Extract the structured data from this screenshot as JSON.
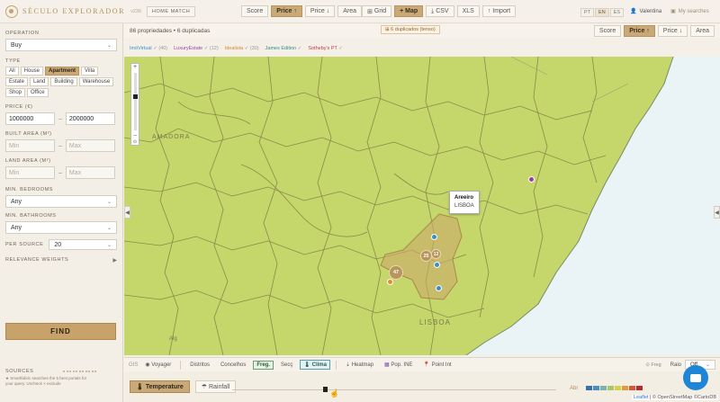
{
  "header": {
    "logo": "SÉCULO EXPLORADOR",
    "version": "v236",
    "home_match": "HOME MATCH",
    "sort": [
      "Score",
      "Price ↑",
      "Price ↓",
      "Area"
    ],
    "views": {
      "grid": "Grid",
      "map": "+ Map",
      "csv": "⤓ CSV",
      "xls": "XLS",
      "import": "↑ Import"
    },
    "langs": [
      "PT",
      "EN",
      "ES"
    ],
    "user": "Valentina",
    "my_searches": "My searches"
  },
  "sidebar": {
    "operation_label": "OPERATION",
    "operation_value": "Buy",
    "type_label": "TYPE",
    "types": [
      "All",
      "House",
      "Apartment",
      "Villa",
      "Estate",
      "Land",
      "Building",
      "Warehouse",
      "Shop",
      "Office"
    ],
    "price_label": "PRICE (€)",
    "price_min": "1000000",
    "price_max": "2000000",
    "built_label": "BUILT AREA (M²)",
    "land_label": "LAND AREA (M²)",
    "min_placeholder": "Min",
    "max_placeholder": "Max",
    "bedrooms_label": "MIN. BEDROOMS",
    "bedrooms_value": "Any",
    "bathrooms_label": "MIN. BATHROOMS",
    "bathrooms_value": "Any",
    "per_source_label": "PER SOURCE",
    "per_source_value": "20",
    "relevance_label": "RELEVANCE WEIGHTS",
    "find": "FIND",
    "sources_label": "SOURCES",
    "sources_note_1": "★ Smartfabric searches the 5 best portals for",
    "sources_note_2": "your query. Uncheck × exclude"
  },
  "results": {
    "count": "86 propriedades • 6 duplicadas",
    "duplicates": "⊞ 6 duplicados (tenso)",
    "sort": [
      "Score",
      "Price ↑",
      "Price ↓",
      "Area"
    ]
  },
  "sources": [
    {
      "name": "ImóVirtual",
      "count": "✓ (40)",
      "color": "#3a8fc9"
    },
    {
      "name": "LuxuryEstate",
      "count": "✓ (12)",
      "color": "#9b3fa3"
    },
    {
      "name": "Idealista",
      "count": "✓ (30)",
      "color": "#d9862a"
    },
    {
      "name": "James Edition",
      "count": "✓",
      "color": "#2a8f8a"
    },
    {
      "name": "Sotheby's PT",
      "count": "✓",
      "color": "#c03a4a"
    }
  ],
  "map": {
    "popup_title": "Areeiro",
    "popup_sub": "LISBOA",
    "labels": {
      "amadora": "AMADORA",
      "lisboa": "LISBOA",
      "alg": "Alg"
    },
    "clusters": [
      "47",
      "25",
      "12"
    ]
  },
  "layers": {
    "items": [
      "Voyager",
      "Distritos",
      "Concelhos",
      "Freg.",
      "Secç",
      "Clima",
      "Heatmap",
      "Pop. INE",
      "Point Int"
    ],
    "right": "⊙ Freg",
    "raio": "Raio",
    "raio_value": "Off"
  },
  "bottom": {
    "temperature": "Temperature",
    "rainfall": "Rainfall",
    "month": "Abr",
    "legend_colors": [
      "#3a6fb0",
      "#4a8ec2",
      "#7fb0b0",
      "#a8c76a",
      "#d9d04a",
      "#e39a3a",
      "#d9553a",
      "#b82a2a"
    ],
    "attribution_leaflet": "Leaflet",
    "attribution_rest": "| © OpenStreetMap ©CartoDB"
  },
  "colors": {
    "accent": "#c7a36b",
    "map_fill": "#c5d66a",
    "sea": "#eaf3f6"
  }
}
